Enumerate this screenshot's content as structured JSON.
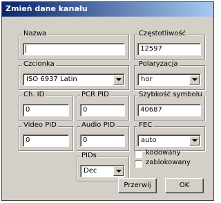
{
  "dialog": {
    "title": "Zmień dane kanału"
  },
  "fields": {
    "nazwa": {
      "label": "Nazwa",
      "value": ""
    },
    "czestotliwosc": {
      "label": "Częstotliwość",
      "value": "12597"
    },
    "czcionka": {
      "label": "Czcionka",
      "value": "ISO 6937 Latin"
    },
    "polaryzacja": {
      "label": "Polaryzacja",
      "value": "hor"
    },
    "ch_id": {
      "label": "Ch. ID",
      "value": "0"
    },
    "pcr_pid": {
      "label": "PCR PID",
      "value": "0"
    },
    "szybkosc": {
      "label": "Szybkość symbolu",
      "value": "40687"
    },
    "video_pid": {
      "label": "Video PID",
      "value": "0"
    },
    "audio_pid": {
      "label": "Audio PID",
      "value": "0"
    },
    "fec": {
      "label": "FEC",
      "value": "auto"
    },
    "pids": {
      "label": "PIDs",
      "value": "Dec"
    }
  },
  "checkboxes": {
    "kodowany": {
      "label": "kodowany",
      "checked": false
    },
    "zablokowany": {
      "label": "zablokowany",
      "checked": false
    }
  },
  "buttons": {
    "cancel": "Przerwij",
    "ok": "OK"
  }
}
